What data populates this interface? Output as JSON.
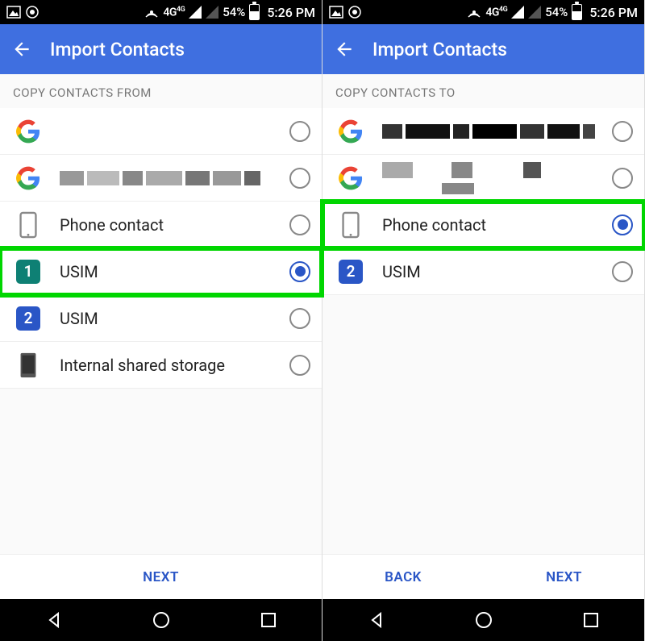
{
  "status": {
    "carrier_mode": "4G",
    "carrier_sup": "4G",
    "battery_pct": "54%",
    "time": "5:26 PM"
  },
  "app_bar": {
    "title": "Import Contacts"
  },
  "left": {
    "section": "COPY CONTACTS FROM",
    "items": [
      {
        "kind": "google",
        "label": "",
        "selected": false,
        "highlighted": false
      },
      {
        "kind": "google_redacted",
        "label": "",
        "selected": false,
        "highlighted": false
      },
      {
        "kind": "phone",
        "label": "Phone contact",
        "selected": false,
        "highlighted": false
      },
      {
        "kind": "sim1",
        "label": "USIM",
        "selected": true,
        "highlighted": true
      },
      {
        "kind": "sim2",
        "label": "USIM",
        "selected": false,
        "highlighted": false
      },
      {
        "kind": "storage",
        "label": "Internal shared storage",
        "selected": false,
        "highlighted": false
      }
    ],
    "footer": {
      "next": "NEXT"
    }
  },
  "right": {
    "section": "COPY CONTACTS TO",
    "items": [
      {
        "kind": "google_redacted_dark",
        "label": "",
        "selected": false,
        "highlighted": false
      },
      {
        "kind": "google_redacted_light",
        "label": "",
        "selected": false,
        "highlighted": false
      },
      {
        "kind": "phone",
        "label": "Phone contact",
        "selected": true,
        "highlighted": true
      },
      {
        "kind": "sim2",
        "label": "USIM",
        "selected": false,
        "highlighted": false
      }
    ],
    "footer": {
      "back": "BACK",
      "next": "NEXT"
    }
  },
  "colors": {
    "appbar": "#3F6FE0",
    "accent": "#2A56C6",
    "highlight": "#00D600",
    "sim1": "#0E8074",
    "sim2": "#2A56C6"
  }
}
